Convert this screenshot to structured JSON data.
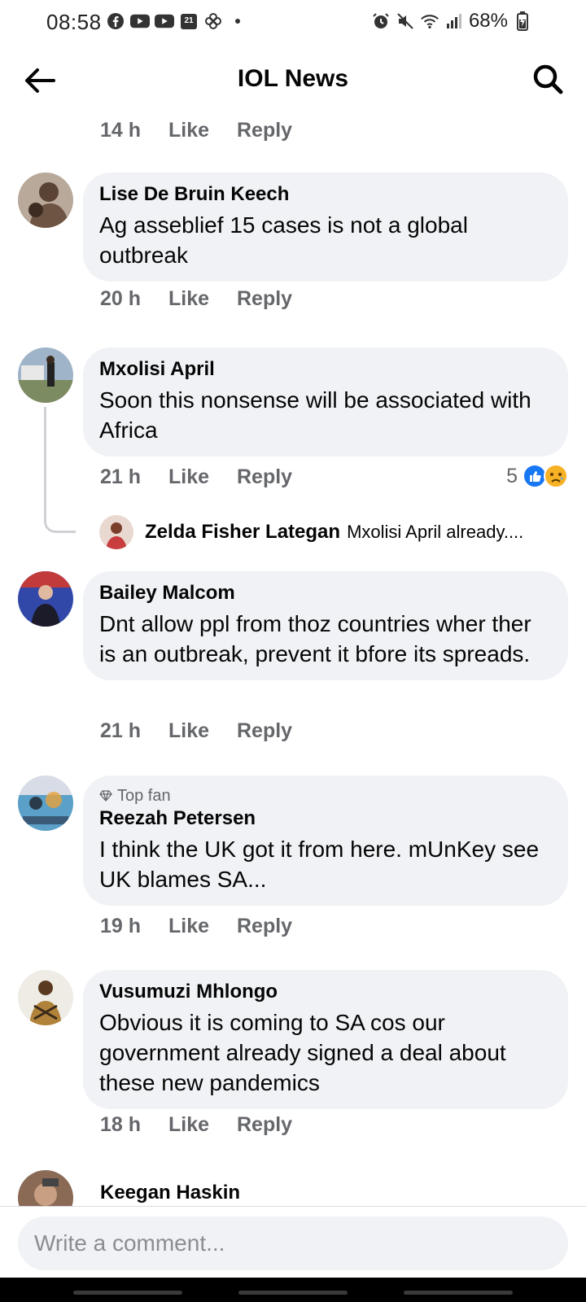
{
  "status_bar": {
    "time": "08:58",
    "date_badge": "21",
    "battery": "68%"
  },
  "header": {
    "title": "IOL News"
  },
  "top_actions": {
    "time": "14 h",
    "like": "Like",
    "reply": "Reply"
  },
  "comments": [
    {
      "name": "Lise De Bruin Keech",
      "text": "Ag asseblief 15 cases is not a global outbreak",
      "time": "20 h",
      "like": "Like",
      "reply": "Reply"
    },
    {
      "name": "Mxolisi April",
      "text": "Soon this nonsense will be associated with Africa",
      "time": "21 h",
      "like": "Like",
      "reply": "Reply",
      "reaction_count": "5",
      "reply_preview": {
        "name": "Zelda Fisher Lategan",
        "text": "Mxolisi April already...."
      }
    },
    {
      "name": "Bailey Malcom",
      "text": "Dnt allow ppl from thoz countries wher ther is an outbreak, prevent it bfore its spreads.",
      "time": "21 h",
      "like": "Like",
      "reply": "Reply"
    },
    {
      "badge": "Top fan",
      "name": "Reezah Petersen",
      "text": "I think the UK got it from here. mUnKey see UK blames SA...",
      "time": "19 h",
      "like": "Like",
      "reply": "Reply"
    },
    {
      "name": "Vusumuzi Mhlongo",
      "text": "Obvious it is coming to SA cos our government already signed a deal about these new pandemics",
      "time": "18 h",
      "like": "Like",
      "reply": "Reply"
    },
    {
      "name": "Keegan Haskin"
    }
  ],
  "composer": {
    "placeholder": "Write a comment..."
  },
  "colors": {
    "bubble": "#f0f2f5",
    "secondary_text": "#65676b",
    "like_blue": "#1877f2",
    "sad_yellow": "#f7b125"
  }
}
